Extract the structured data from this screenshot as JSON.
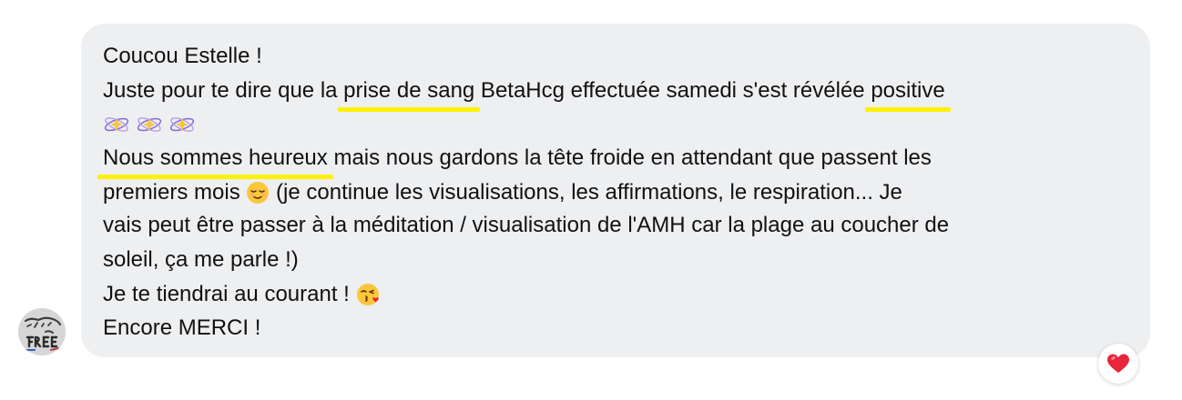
{
  "message": {
    "line1": "Coucou Estelle !",
    "line2_a": "Juste pour te dire que la ",
    "line2_hl1": "prise de sang",
    "line2_b": " BetaHcg effectuée samedi s'est révélée ",
    "line2_hl2": "positive",
    "sparkle_icons": [
      "sparkle-atom-icon",
      "sparkle-atom-icon",
      "sparkle-atom-icon"
    ],
    "line4_hl": "Nous sommes heureux",
    "line4_b": " mais nous gardons la tête froide en attendant que passent les",
    "line5_a": "premiers mois ",
    "line5_b": " (je continue les visualisations, les affirmations, le respiration... Je",
    "line6": "vais peut être passer à la méditation / visualisation de l'AMH car la plage au coucher de",
    "line7": "soleil, ça me parle !)",
    "line8_a": "Je te tiendrai au courant ! ",
    "line9": "Encore MERCI !"
  },
  "avatar": {
    "logo_text": "Kindness Be FREE",
    "icon": "profile-avatar"
  },
  "reaction": {
    "icon": "heart-reaction-icon",
    "color": "#e8253a"
  },
  "colors": {
    "bubble": "#eeeff1",
    "highlight": "#fff200",
    "text": "#111111"
  }
}
